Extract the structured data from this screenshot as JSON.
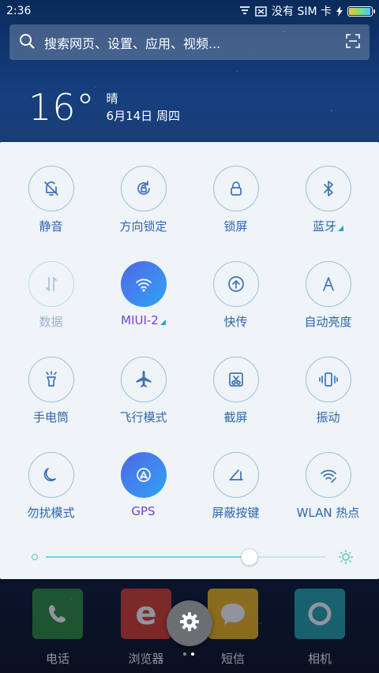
{
  "status_bar": {
    "time": "2:36",
    "carrier": "没有 SIM 卡",
    "battery_level": 0.95
  },
  "search": {
    "placeholder": "搜索网页、设置、应用、视频..."
  },
  "weather": {
    "temperature": "16°",
    "condition": "晴",
    "date": "6月14日 周四"
  },
  "toggles": [
    {
      "label": "静音",
      "icon": "bell-off-icon",
      "state": "off"
    },
    {
      "label": "方向锁定",
      "icon": "rotation-lock-icon",
      "state": "off"
    },
    {
      "label": "锁屏",
      "icon": "lock-icon",
      "state": "off"
    },
    {
      "label": "蓝牙",
      "icon": "bluetooth-icon",
      "state": "off",
      "has_more": true
    },
    {
      "label": "数据",
      "icon": "data-icon",
      "state": "disabled"
    },
    {
      "label": "MIUI-2",
      "icon": "wifi-icon",
      "state": "on",
      "has_more": true
    },
    {
      "label": "快传",
      "icon": "quick-transfer-icon",
      "state": "off"
    },
    {
      "label": "自动亮度",
      "icon": "auto-brightness-icon",
      "state": "off"
    },
    {
      "label": "手电筒",
      "icon": "flashlight-icon",
      "state": "off"
    },
    {
      "label": "飞行模式",
      "icon": "airplane-icon",
      "state": "off"
    },
    {
      "label": "截屏",
      "icon": "screenshot-icon",
      "state": "off"
    },
    {
      "label": "振动",
      "icon": "vibrate-icon",
      "state": "off"
    },
    {
      "label": "勿扰模式",
      "icon": "moon-icon",
      "state": "off"
    },
    {
      "label": "GPS",
      "icon": "gps-icon",
      "state": "on"
    },
    {
      "label": "屏蔽按键",
      "icon": "block-keys-icon",
      "state": "off"
    },
    {
      "label": "WLAN 热点",
      "icon": "hotspot-icon",
      "state": "off"
    }
  ],
  "brightness": {
    "level": 0.73
  },
  "dock": [
    {
      "name": "电话",
      "icon": "phone-icon",
      "color": "#2e8b3a"
    },
    {
      "name": "浏览器",
      "icon": "browser-icon",
      "color": "#d93b2b"
    },
    {
      "name": "短信",
      "icon": "message-icon",
      "color": "#f3b516"
    },
    {
      "name": "相机",
      "icon": "camera-icon",
      "color": "#23a2a9"
    }
  ],
  "colors": {
    "accent": "#3d8bf0",
    "label": "#2f66b0",
    "active_label": "#7a3fd4"
  }
}
